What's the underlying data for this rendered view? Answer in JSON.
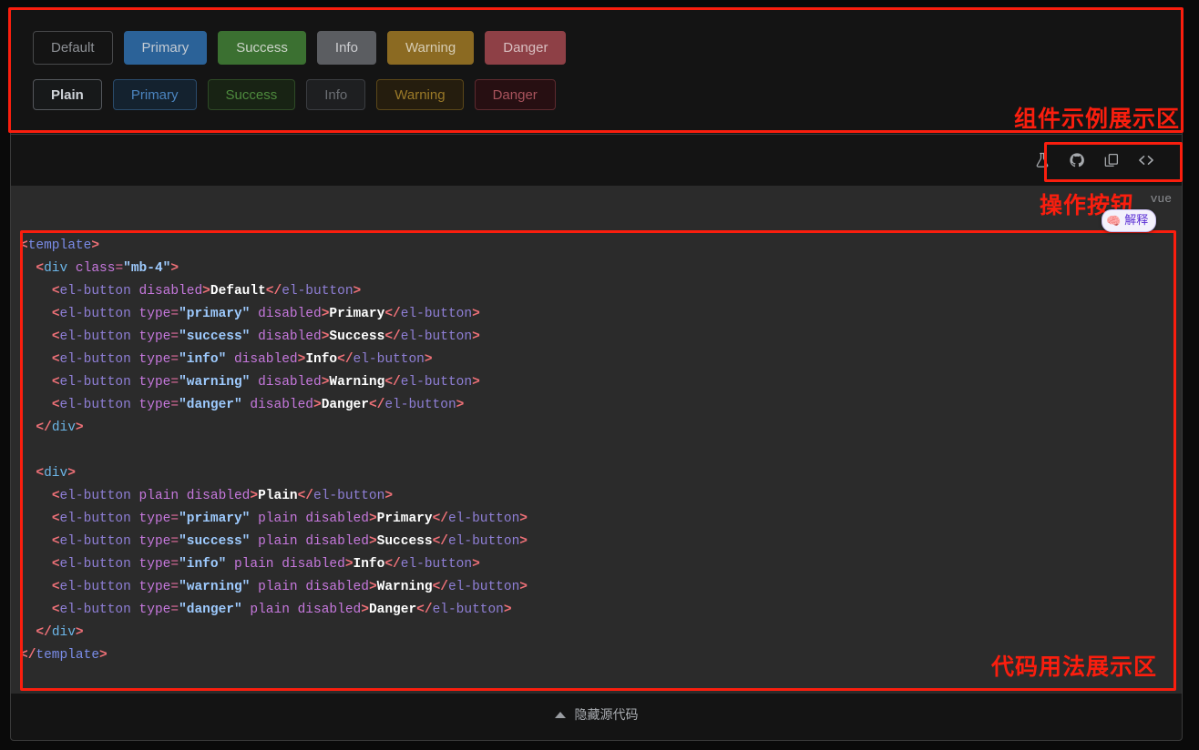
{
  "showcase": {
    "row1": [
      {
        "label": "Default",
        "variant": "b-default",
        "name": "button-default"
      },
      {
        "label": "Primary",
        "variant": "b-primary",
        "name": "button-primary"
      },
      {
        "label": "Success",
        "variant": "b-success",
        "name": "button-success"
      },
      {
        "label": "Info",
        "variant": "b-info",
        "name": "button-info"
      },
      {
        "label": "Warning",
        "variant": "b-warning",
        "name": "button-warning"
      },
      {
        "label": "Danger",
        "variant": "b-danger",
        "name": "button-danger"
      }
    ],
    "row2": [
      {
        "label": "Plain",
        "variant": "p-plain",
        "name": "button-plain"
      },
      {
        "label": "Primary",
        "variant": "p-primary",
        "name": "button-plain-primary"
      },
      {
        "label": "Success",
        "variant": "p-success",
        "name": "button-plain-success"
      },
      {
        "label": "Info",
        "variant": "p-info",
        "name": "button-plain-info"
      },
      {
        "label": "Warning",
        "variant": "p-warning",
        "name": "button-plain-warning"
      },
      {
        "label": "Danger",
        "variant": "p-danger",
        "name": "button-plain-danger"
      }
    ]
  },
  "toolbar": {
    "icons": [
      {
        "name": "flask-playground-icon",
        "title": "playground"
      },
      {
        "name": "github-icon",
        "title": "github"
      },
      {
        "name": "copy-icon",
        "title": "copy"
      },
      {
        "name": "code-brackets-icon",
        "title": "source"
      }
    ]
  },
  "meta": {
    "lang_label": "vue"
  },
  "code": {
    "language": "vue",
    "lines": [
      [
        {
          "t": "brk",
          "v": "<"
        },
        {
          "t": "tag",
          "v": "template"
        },
        {
          "t": "brk",
          "v": ">"
        }
      ],
      [
        {
          "t": "plain",
          "v": "  "
        },
        {
          "t": "brk",
          "v": "<"
        },
        {
          "t": "tag2",
          "v": "div"
        },
        {
          "t": "plain",
          "v": " "
        },
        {
          "t": "attr",
          "v": "class"
        },
        {
          "t": "eq",
          "v": "="
        },
        {
          "t": "str",
          "v": "\"mb-4\""
        },
        {
          "t": "brk",
          "v": ">"
        }
      ],
      [
        {
          "t": "plain",
          "v": "    "
        },
        {
          "t": "brk",
          "v": "<"
        },
        {
          "t": "comp",
          "v": "el-button"
        },
        {
          "t": "plain",
          "v": " "
        },
        {
          "t": "attr",
          "v": "disabled"
        },
        {
          "t": "brk",
          "v": ">"
        },
        {
          "t": "txt",
          "v": "Default"
        },
        {
          "t": "brk",
          "v": "</"
        },
        {
          "t": "comp",
          "v": "el-button"
        },
        {
          "t": "brk",
          "v": ">"
        }
      ],
      [
        {
          "t": "plain",
          "v": "    "
        },
        {
          "t": "brk",
          "v": "<"
        },
        {
          "t": "comp",
          "v": "el-button"
        },
        {
          "t": "plain",
          "v": " "
        },
        {
          "t": "attr",
          "v": "type"
        },
        {
          "t": "eq",
          "v": "="
        },
        {
          "t": "str",
          "v": "\"primary\""
        },
        {
          "t": "plain",
          "v": " "
        },
        {
          "t": "attr",
          "v": "disabled"
        },
        {
          "t": "brk",
          "v": ">"
        },
        {
          "t": "txt",
          "v": "Primary"
        },
        {
          "t": "brk",
          "v": "</"
        },
        {
          "t": "comp",
          "v": "el-button"
        },
        {
          "t": "brk",
          "v": ">"
        }
      ],
      [
        {
          "t": "plain",
          "v": "    "
        },
        {
          "t": "brk",
          "v": "<"
        },
        {
          "t": "comp",
          "v": "el-button"
        },
        {
          "t": "plain",
          "v": " "
        },
        {
          "t": "attr",
          "v": "type"
        },
        {
          "t": "eq",
          "v": "="
        },
        {
          "t": "str",
          "v": "\"success\""
        },
        {
          "t": "plain",
          "v": " "
        },
        {
          "t": "attr",
          "v": "disabled"
        },
        {
          "t": "brk",
          "v": ">"
        },
        {
          "t": "txt",
          "v": "Success"
        },
        {
          "t": "brk",
          "v": "</"
        },
        {
          "t": "comp",
          "v": "el-button"
        },
        {
          "t": "brk",
          "v": ">"
        }
      ],
      [
        {
          "t": "plain",
          "v": "    "
        },
        {
          "t": "brk",
          "v": "<"
        },
        {
          "t": "comp",
          "v": "el-button"
        },
        {
          "t": "plain",
          "v": " "
        },
        {
          "t": "attr",
          "v": "type"
        },
        {
          "t": "eq",
          "v": "="
        },
        {
          "t": "str",
          "v": "\"info\""
        },
        {
          "t": "plain",
          "v": " "
        },
        {
          "t": "attr",
          "v": "disabled"
        },
        {
          "t": "brk",
          "v": ">"
        },
        {
          "t": "txt",
          "v": "Info"
        },
        {
          "t": "brk",
          "v": "</"
        },
        {
          "t": "comp",
          "v": "el-button"
        },
        {
          "t": "brk",
          "v": ">"
        }
      ],
      [
        {
          "t": "plain",
          "v": "    "
        },
        {
          "t": "brk",
          "v": "<"
        },
        {
          "t": "comp",
          "v": "el-button"
        },
        {
          "t": "plain",
          "v": " "
        },
        {
          "t": "attr",
          "v": "type"
        },
        {
          "t": "eq",
          "v": "="
        },
        {
          "t": "str",
          "v": "\"warning\""
        },
        {
          "t": "plain",
          "v": " "
        },
        {
          "t": "attr",
          "v": "disabled"
        },
        {
          "t": "brk",
          "v": ">"
        },
        {
          "t": "txt",
          "v": "Warning"
        },
        {
          "t": "brk",
          "v": "</"
        },
        {
          "t": "comp",
          "v": "el-button"
        },
        {
          "t": "brk",
          "v": ">"
        }
      ],
      [
        {
          "t": "plain",
          "v": "    "
        },
        {
          "t": "brk",
          "v": "<"
        },
        {
          "t": "comp",
          "v": "el-button"
        },
        {
          "t": "plain",
          "v": " "
        },
        {
          "t": "attr",
          "v": "type"
        },
        {
          "t": "eq",
          "v": "="
        },
        {
          "t": "str",
          "v": "\"danger\""
        },
        {
          "t": "plain",
          "v": " "
        },
        {
          "t": "attr",
          "v": "disabled"
        },
        {
          "t": "brk",
          "v": ">"
        },
        {
          "t": "txt",
          "v": "Danger"
        },
        {
          "t": "brk",
          "v": "</"
        },
        {
          "t": "comp",
          "v": "el-button"
        },
        {
          "t": "brk",
          "v": ">"
        }
      ],
      [
        {
          "t": "plain",
          "v": "  "
        },
        {
          "t": "brk",
          "v": "</"
        },
        {
          "t": "tag2",
          "v": "div"
        },
        {
          "t": "brk",
          "v": ">"
        }
      ],
      [
        {
          "t": "plain",
          "v": ""
        }
      ],
      [
        {
          "t": "plain",
          "v": "  "
        },
        {
          "t": "brk",
          "v": "<"
        },
        {
          "t": "tag2",
          "v": "div"
        },
        {
          "t": "brk",
          "v": ">"
        }
      ],
      [
        {
          "t": "plain",
          "v": "    "
        },
        {
          "t": "brk",
          "v": "<"
        },
        {
          "t": "comp",
          "v": "el-button"
        },
        {
          "t": "plain",
          "v": " "
        },
        {
          "t": "attr",
          "v": "plain"
        },
        {
          "t": "plain",
          "v": " "
        },
        {
          "t": "attr",
          "v": "disabled"
        },
        {
          "t": "brk",
          "v": ">"
        },
        {
          "t": "txt",
          "v": "Plain"
        },
        {
          "t": "brk",
          "v": "</"
        },
        {
          "t": "comp",
          "v": "el-button"
        },
        {
          "t": "brk",
          "v": ">"
        }
      ],
      [
        {
          "t": "plain",
          "v": "    "
        },
        {
          "t": "brk",
          "v": "<"
        },
        {
          "t": "comp",
          "v": "el-button"
        },
        {
          "t": "plain",
          "v": " "
        },
        {
          "t": "attr",
          "v": "type"
        },
        {
          "t": "eq",
          "v": "="
        },
        {
          "t": "str",
          "v": "\"primary\""
        },
        {
          "t": "plain",
          "v": " "
        },
        {
          "t": "attr",
          "v": "plain"
        },
        {
          "t": "plain",
          "v": " "
        },
        {
          "t": "attr",
          "v": "disabled"
        },
        {
          "t": "brk",
          "v": ">"
        },
        {
          "t": "txt",
          "v": "Primary"
        },
        {
          "t": "brk",
          "v": "</"
        },
        {
          "t": "comp",
          "v": "el-button"
        },
        {
          "t": "brk",
          "v": ">"
        }
      ],
      [
        {
          "t": "plain",
          "v": "    "
        },
        {
          "t": "brk",
          "v": "<"
        },
        {
          "t": "comp",
          "v": "el-button"
        },
        {
          "t": "plain",
          "v": " "
        },
        {
          "t": "attr",
          "v": "type"
        },
        {
          "t": "eq",
          "v": "="
        },
        {
          "t": "str",
          "v": "\"success\""
        },
        {
          "t": "plain",
          "v": " "
        },
        {
          "t": "attr",
          "v": "plain"
        },
        {
          "t": "plain",
          "v": " "
        },
        {
          "t": "attr",
          "v": "disabled"
        },
        {
          "t": "brk",
          "v": ">"
        },
        {
          "t": "txt",
          "v": "Success"
        },
        {
          "t": "brk",
          "v": "</"
        },
        {
          "t": "comp",
          "v": "el-button"
        },
        {
          "t": "brk",
          "v": ">"
        }
      ],
      [
        {
          "t": "plain",
          "v": "    "
        },
        {
          "t": "brk",
          "v": "<"
        },
        {
          "t": "comp",
          "v": "el-button"
        },
        {
          "t": "plain",
          "v": " "
        },
        {
          "t": "attr",
          "v": "type"
        },
        {
          "t": "eq",
          "v": "="
        },
        {
          "t": "str",
          "v": "\"info\""
        },
        {
          "t": "plain",
          "v": " "
        },
        {
          "t": "attr",
          "v": "plain"
        },
        {
          "t": "plain",
          "v": " "
        },
        {
          "t": "attr",
          "v": "disabled"
        },
        {
          "t": "brk",
          "v": ">"
        },
        {
          "t": "txt",
          "v": "Info"
        },
        {
          "t": "brk",
          "v": "</"
        },
        {
          "t": "comp",
          "v": "el-button"
        },
        {
          "t": "brk",
          "v": ">"
        }
      ],
      [
        {
          "t": "plain",
          "v": "    "
        },
        {
          "t": "brk",
          "v": "<"
        },
        {
          "t": "comp",
          "v": "el-button"
        },
        {
          "t": "plain",
          "v": " "
        },
        {
          "t": "attr",
          "v": "type"
        },
        {
          "t": "eq",
          "v": "="
        },
        {
          "t": "str",
          "v": "\"warning\""
        },
        {
          "t": "plain",
          "v": " "
        },
        {
          "t": "attr",
          "v": "plain"
        },
        {
          "t": "plain",
          "v": " "
        },
        {
          "t": "attr",
          "v": "disabled"
        },
        {
          "t": "brk",
          "v": ">"
        },
        {
          "t": "txt",
          "v": "Warning"
        },
        {
          "t": "brk",
          "v": "</"
        },
        {
          "t": "comp",
          "v": "el-button"
        },
        {
          "t": "brk",
          "v": ">"
        }
      ],
      [
        {
          "t": "plain",
          "v": "    "
        },
        {
          "t": "brk",
          "v": "<"
        },
        {
          "t": "comp",
          "v": "el-button"
        },
        {
          "t": "plain",
          "v": " "
        },
        {
          "t": "attr",
          "v": "type"
        },
        {
          "t": "eq",
          "v": "="
        },
        {
          "t": "str",
          "v": "\"danger\""
        },
        {
          "t": "plain",
          "v": " "
        },
        {
          "t": "attr",
          "v": "plain"
        },
        {
          "t": "plain",
          "v": " "
        },
        {
          "t": "attr",
          "v": "disabled"
        },
        {
          "t": "brk",
          "v": ">"
        },
        {
          "t": "txt",
          "v": "Danger"
        },
        {
          "t": "brk",
          "v": "</"
        },
        {
          "t": "comp",
          "v": "el-button"
        },
        {
          "t": "brk",
          "v": ">"
        }
      ],
      [
        {
          "t": "plain",
          "v": "  "
        },
        {
          "t": "brk",
          "v": "</"
        },
        {
          "t": "tag2",
          "v": "div"
        },
        {
          "t": "brk",
          "v": ">"
        }
      ],
      [
        {
          "t": "brk",
          "v": "</"
        },
        {
          "t": "tag",
          "v": "template"
        },
        {
          "t": "brk",
          "v": ">"
        }
      ]
    ]
  },
  "footer": {
    "toggle_label": "隐藏源代码"
  },
  "annotations": {
    "showcase_area": "组件示例展示区",
    "action_buttons": "操作按钮",
    "code_area": "代码用法展示区",
    "color": "#fa1e0e"
  },
  "explain_badge": {
    "icon": "brain-icon",
    "glyph": "🧠",
    "label": "解释"
  }
}
